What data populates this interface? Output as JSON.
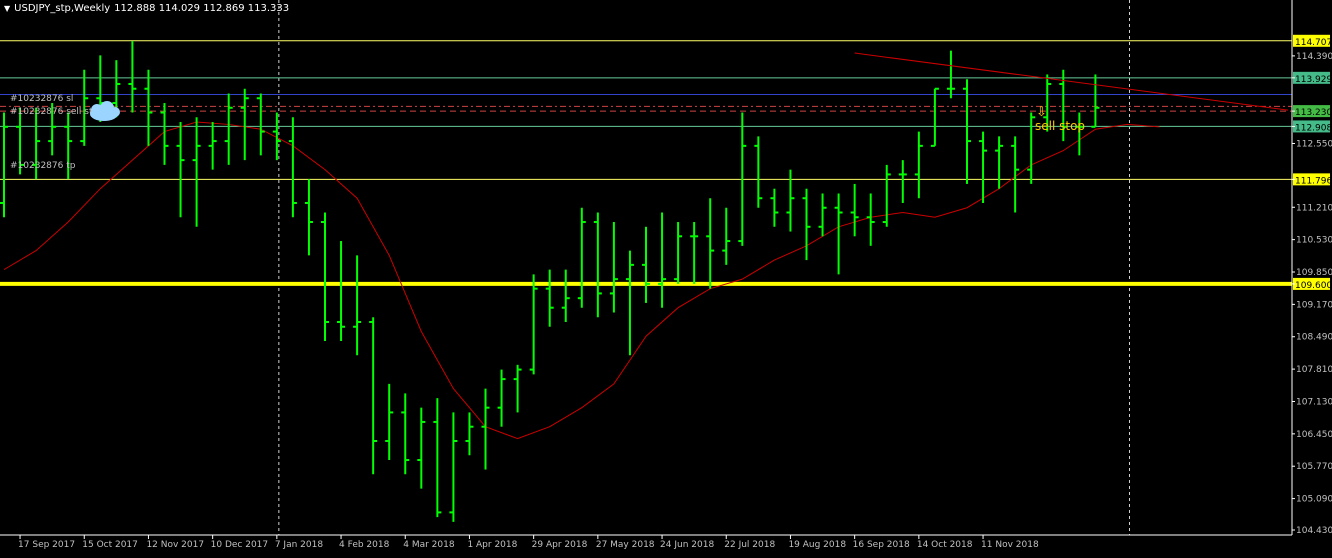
{
  "header": {
    "symbol_period": "USDJPY_stp,Weekly",
    "ohlc": "112.888 114.029 112.869 113.333"
  },
  "colors": {
    "background": "#000000",
    "bar_up": "#00ff00",
    "ma": "#cc0000",
    "trendline": "#cc0000",
    "support": "#ffff00",
    "level_yellow": "#ffff66",
    "level_green": "#66cc99",
    "level_blue": "#3344cc",
    "order_dash": "#cc4444",
    "annotation": "#ffcc00",
    "axis_text": "#c0c0c0"
  },
  "orders": {
    "sl_label": "#10232876 sl",
    "sell_stop_label": "#10232876 sell stop",
    "tp_label": "#10232876 tp"
  },
  "annotation": {
    "arrow": "⇩",
    "text": "sell stop"
  },
  "icons": {
    "cloud": "cloud-icon",
    "menu": "triangle-down-icon"
  },
  "chart_data": {
    "type": "ohlc",
    "timeframe": "Weekly",
    "ylim": [
      104.43,
      115.27
    ],
    "y_ticks": [
      "114.390",
      "113.929",
      "113.230",
      "112.908",
      "112.550",
      "111.796",
      "111.210",
      "110.530",
      "109.850",
      "109.600",
      "109.170",
      "108.490",
      "107.810",
      "107.130",
      "106.450",
      "105.770",
      "105.090",
      "104.430"
    ],
    "x_labels": [
      {
        "bar": 1,
        "text": "17 Sep 2017"
      },
      {
        "bar": 5,
        "text": "15 Oct 2017"
      },
      {
        "bar": 9,
        "text": "12 Nov 2017"
      },
      {
        "bar": 13,
        "text": "10 Dec 2017"
      },
      {
        "bar": 17,
        "text": "7 Jan 2018"
      },
      {
        "bar": 21,
        "text": "4 Feb 2018"
      },
      {
        "bar": 25,
        "text": "4 Mar 2018"
      },
      {
        "bar": 29,
        "text": "1 Apr 2018"
      },
      {
        "bar": 33,
        "text": "29 Apr 2018"
      },
      {
        "bar": 37,
        "text": "27 May 2018"
      },
      {
        "bar": 41,
        "text": "24 Jun 2018"
      },
      {
        "bar": 45,
        "text": "22 Jul 2018"
      },
      {
        "bar": 49,
        "text": "19 Aug 2018"
      },
      {
        "bar": 53,
        "text": "16 Sep 2018"
      },
      {
        "bar": 57,
        "text": "14 Oct 2018"
      },
      {
        "bar": 61,
        "text": "11 Nov 2018"
      }
    ],
    "period_separators": [
      17,
      70
    ],
    "bars": [
      {
        "o": 111.3,
        "h": 113.2,
        "l": 111.0,
        "c": 112.9
      },
      {
        "o": 112.9,
        "h": 113.3,
        "l": 111.9,
        "c": 112.1
      },
      {
        "o": 112.1,
        "h": 113.3,
        "l": 111.8,
        "c": 112.6
      },
      {
        "o": 112.6,
        "h": 113.4,
        "l": 112.3,
        "c": 112.9
      },
      {
        "o": 112.9,
        "h": 113.2,
        "l": 111.8,
        "c": 112.6
      },
      {
        "o": 112.6,
        "h": 114.1,
        "l": 112.5,
        "c": 113.5
      },
      {
        "o": 113.5,
        "h": 114.4,
        "l": 113.0,
        "c": 113.4
      },
      {
        "o": 113.4,
        "h": 114.3,
        "l": 113.1,
        "c": 113.8
      },
      {
        "o": 113.8,
        "h": 114.7,
        "l": 113.2,
        "c": 113.7
      },
      {
        "o": 113.7,
        "h": 114.1,
        "l": 112.5,
        "c": 113.2
      },
      {
        "o": 113.2,
        "h": 113.4,
        "l": 112.1,
        "c": 112.5
      },
      {
        "o": 112.5,
        "h": 113.0,
        "l": 111.0,
        "c": 112.2
      },
      {
        "o": 112.2,
        "h": 113.1,
        "l": 110.8,
        "c": 112.5
      },
      {
        "o": 112.5,
        "h": 113.0,
        "l": 112.0,
        "c": 112.6
      },
      {
        "o": 112.6,
        "h": 113.6,
        "l": 112.1,
        "c": 113.3
      },
      {
        "o": 113.3,
        "h": 113.7,
        "l": 112.2,
        "c": 113.5
      },
      {
        "o": 113.5,
        "h": 113.6,
        "l": 112.3,
        "c": 112.8
      },
      {
        "o": 112.8,
        "h": 113.2,
        "l": 112.2,
        "c": 112.6
      },
      {
        "o": 112.6,
        "h": 113.1,
        "l": 111.0,
        "c": 111.3
      },
      {
        "o": 111.3,
        "h": 111.8,
        "l": 110.2,
        "c": 110.9
      },
      {
        "o": 110.9,
        "h": 111.1,
        "l": 108.4,
        "c": 108.8
      },
      {
        "o": 108.8,
        "h": 110.5,
        "l": 108.4,
        "c": 108.7
      },
      {
        "o": 108.7,
        "h": 110.2,
        "l": 108.1,
        "c": 108.8
      },
      {
        "o": 108.8,
        "h": 108.9,
        "l": 105.6,
        "c": 106.3
      },
      {
        "o": 106.3,
        "h": 107.5,
        "l": 105.9,
        "c": 106.9
      },
      {
        "o": 106.9,
        "h": 107.3,
        "l": 105.6,
        "c": 105.9
      },
      {
        "o": 105.9,
        "h": 107.0,
        "l": 105.3,
        "c": 106.7
      },
      {
        "o": 106.7,
        "h": 107.2,
        "l": 104.7,
        "c": 104.8
      },
      {
        "o": 104.8,
        "h": 106.9,
        "l": 104.6,
        "c": 106.3
      },
      {
        "o": 106.3,
        "h": 106.9,
        "l": 106.0,
        "c": 106.6
      },
      {
        "o": 106.6,
        "h": 107.4,
        "l": 105.7,
        "c": 107.0
      },
      {
        "o": 107.0,
        "h": 107.8,
        "l": 106.6,
        "c": 107.6
      },
      {
        "o": 107.6,
        "h": 107.9,
        "l": 106.9,
        "c": 107.8
      },
      {
        "o": 107.8,
        "h": 109.8,
        "l": 107.7,
        "c": 109.5
      },
      {
        "o": 109.5,
        "h": 109.9,
        "l": 108.7,
        "c": 109.1
      },
      {
        "o": 109.1,
        "h": 109.9,
        "l": 108.8,
        "c": 109.3
      },
      {
        "o": 109.3,
        "h": 111.2,
        "l": 109.1,
        "c": 110.9
      },
      {
        "o": 110.9,
        "h": 111.1,
        "l": 108.9,
        "c": 109.4
      },
      {
        "o": 109.4,
        "h": 110.9,
        "l": 109.0,
        "c": 109.7
      },
      {
        "o": 109.7,
        "h": 110.3,
        "l": 108.1,
        "c": 110.0
      },
      {
        "o": 110.0,
        "h": 110.8,
        "l": 109.2,
        "c": 109.6
      },
      {
        "o": 109.6,
        "h": 111.1,
        "l": 109.1,
        "c": 109.7
      },
      {
        "o": 109.7,
        "h": 110.9,
        "l": 109.6,
        "c": 110.6
      },
      {
        "o": 110.6,
        "h": 110.9,
        "l": 109.6,
        "c": 110.6
      },
      {
        "o": 110.6,
        "h": 111.4,
        "l": 109.5,
        "c": 110.3
      },
      {
        "o": 110.3,
        "h": 111.2,
        "l": 110.0,
        "c": 110.5
      },
      {
        "o": 110.5,
        "h": 113.2,
        "l": 110.4,
        "c": 112.5
      },
      {
        "o": 112.5,
        "h": 112.7,
        "l": 111.2,
        "c": 111.4
      },
      {
        "o": 111.4,
        "h": 111.6,
        "l": 110.8,
        "c": 111.1
      },
      {
        "o": 111.1,
        "h": 112.0,
        "l": 110.7,
        "c": 111.4
      },
      {
        "o": 111.4,
        "h": 111.6,
        "l": 110.1,
        "c": 110.8
      },
      {
        "o": 110.8,
        "h": 111.5,
        "l": 110.6,
        "c": 111.2
      },
      {
        "o": 111.2,
        "h": 111.5,
        "l": 109.8,
        "c": 111.1
      },
      {
        "o": 111.1,
        "h": 111.7,
        "l": 110.6,
        "c": 111.0
      },
      {
        "o": 111.0,
        "h": 111.5,
        "l": 110.4,
        "c": 110.9
      },
      {
        "o": 110.9,
        "h": 112.1,
        "l": 110.8,
        "c": 111.9
      },
      {
        "o": 111.9,
        "h": 112.2,
        "l": 111.3,
        "c": 111.9
      },
      {
        "o": 111.9,
        "h": 112.8,
        "l": 111.4,
        "c": 112.5
      },
      {
        "o": 112.5,
        "h": 113.7,
        "l": 112.5,
        "c": 113.7
      },
      {
        "o": 113.7,
        "h": 114.5,
        "l": 113.5,
        "c": 113.7
      },
      {
        "o": 113.7,
        "h": 113.9,
        "l": 111.7,
        "c": 112.6
      },
      {
        "o": 112.6,
        "h": 112.8,
        "l": 111.3,
        "c": 112.4
      },
      {
        "o": 112.4,
        "h": 112.7,
        "l": 111.6,
        "c": 112.5
      },
      {
        "o": 112.5,
        "h": 112.7,
        "l": 111.1,
        "c": 112.0
      },
      {
        "o": 112.0,
        "h": 113.2,
        "l": 111.7,
        "c": 113.1
      },
      {
        "o": 113.1,
        "h": 114.0,
        "l": 112.8,
        "c": 113.8
      },
      {
        "o": 113.8,
        "h": 114.1,
        "l": 112.6,
        "c": 112.9
      },
      {
        "o": 112.9,
        "h": 113.2,
        "l": 112.3,
        "c": 112.9
      },
      {
        "o": 112.9,
        "h": 114.0,
        "l": 112.9,
        "c": 113.3
      }
    ],
    "moving_average": {
      "name": "",
      "points": [
        {
          "bar": 0,
          "v": 109.9
        },
        {
          "bar": 2,
          "v": 110.3
        },
        {
          "bar": 4,
          "v": 110.9
        },
        {
          "bar": 6,
          "v": 111.6
        },
        {
          "bar": 8,
          "v": 112.2
        },
        {
          "bar": 10,
          "v": 112.8
        },
        {
          "bar": 12,
          "v": 113.0
        },
        {
          "bar": 14,
          "v": 112.95
        },
        {
          "bar": 16,
          "v": 112.85
        },
        {
          "bar": 18,
          "v": 112.5
        },
        {
          "bar": 20,
          "v": 112.0
        },
        {
          "bar": 22,
          "v": 111.4
        },
        {
          "bar": 24,
          "v": 110.2
        },
        {
          "bar": 26,
          "v": 108.6
        },
        {
          "bar": 28,
          "v": 107.4
        },
        {
          "bar": 30,
          "v": 106.6
        },
        {
          "bar": 32,
          "v": 106.35
        },
        {
          "bar": 34,
          "v": 106.6
        },
        {
          "bar": 36,
          "v": 107.0
        },
        {
          "bar": 38,
          "v": 107.5
        },
        {
          "bar": 40,
          "v": 108.5
        },
        {
          "bar": 42,
          "v": 109.1
        },
        {
          "bar": 44,
          "v": 109.5
        },
        {
          "bar": 46,
          "v": 109.7
        },
        {
          "bar": 48,
          "v": 110.1
        },
        {
          "bar": 50,
          "v": 110.4
        },
        {
          "bar": 52,
          "v": 110.8
        },
        {
          "bar": 54,
          "v": 111.0
        },
        {
          "bar": 56,
          "v": 111.1
        },
        {
          "bar": 58,
          "v": 111.0
        },
        {
          "bar": 60,
          "v": 111.2
        },
        {
          "bar": 62,
          "v": 111.6
        },
        {
          "bar": 64,
          "v": 112.1
        },
        {
          "bar": 66,
          "v": 112.4
        },
        {
          "bar": 68,
          "v": 112.85
        },
        {
          "bar": 70,
          "v": 112.95
        },
        {
          "bar": 72,
          "v": 112.9
        }
      ]
    },
    "trendline": {
      "from": {
        "bar": 53,
        "v": 114.45
      },
      "to": {
        "bar": 80,
        "v": 113.25
      }
    },
    "levels": [
      {
        "value": 114.707,
        "label": "114.707",
        "kind": "yellow-thin"
      },
      {
        "value": 113.929,
        "label": "113.929",
        "kind": "green"
      },
      {
        "value": 113.58,
        "label": "",
        "kind": "blue"
      },
      {
        "value": 113.33,
        "label": "",
        "kind": "dash-sl"
      },
      {
        "value": 113.23,
        "label": "113.230",
        "kind": "dash-entry"
      },
      {
        "value": 112.908,
        "label": "112.908",
        "kind": "green"
      },
      {
        "value": 111.796,
        "label": "111.796",
        "kind": "yellow-thin"
      },
      {
        "value": 109.6,
        "label": "109.600",
        "kind": "support"
      }
    ]
  }
}
